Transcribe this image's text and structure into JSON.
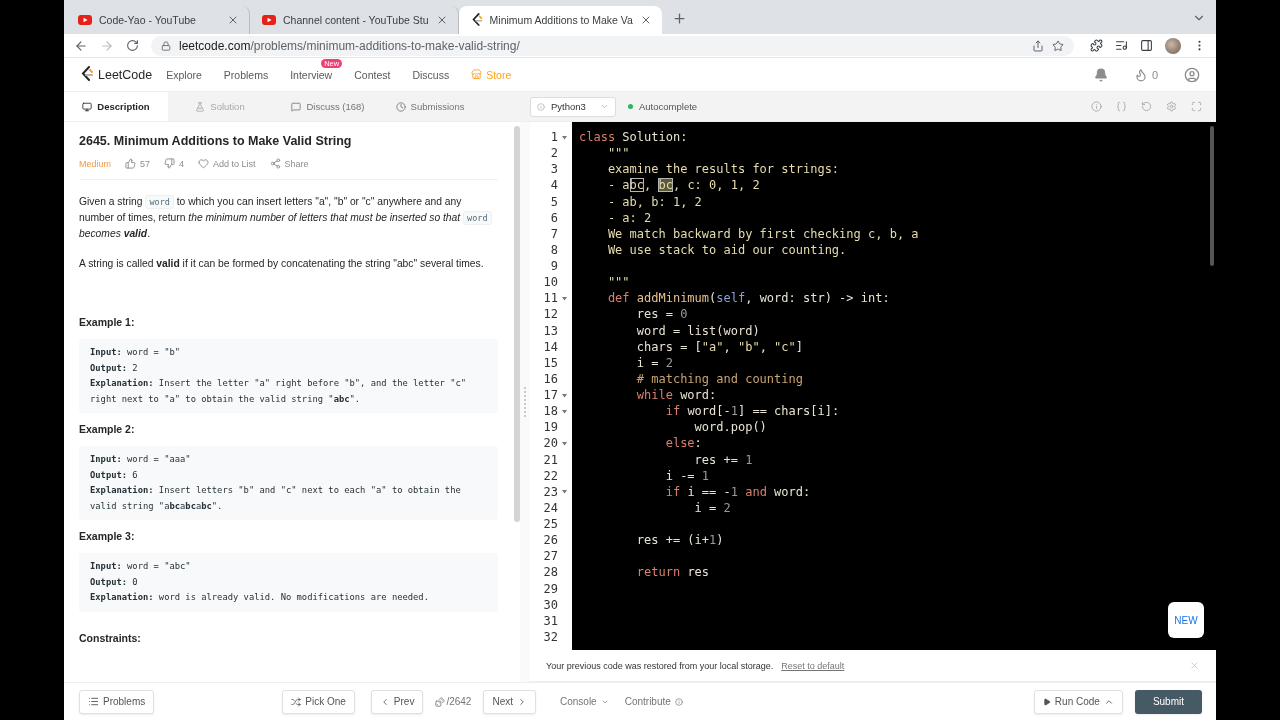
{
  "browser": {
    "tabs": [
      {
        "title": "Code-Yao - YouTube",
        "selected": false
      },
      {
        "title": "Channel content - YouTube Stu",
        "selected": false
      },
      {
        "title": "Minimum Additions to Make Va",
        "selected": true
      }
    ],
    "url": {
      "host": "leetcode.com",
      "path": "/problems/minimum-additions-to-make-valid-string/"
    }
  },
  "nav": {
    "logo": "LeetCode",
    "items": [
      {
        "label": "Explore"
      },
      {
        "label": "Problems"
      },
      {
        "label": "Interview",
        "badge": "New"
      },
      {
        "label": "Contest"
      },
      {
        "label": "Discuss"
      }
    ],
    "store": "Store",
    "streak": "0"
  },
  "panel_tabs": [
    {
      "label": "Description",
      "selected": true,
      "disabled": false
    },
    {
      "label": "Solution",
      "selected": false,
      "disabled": true
    },
    {
      "label": "Discuss (168)",
      "selected": false,
      "disabled": false
    },
    {
      "label": "Submissions",
      "selected": false,
      "disabled": false
    }
  ],
  "problem": {
    "title": "2645. Minimum Additions to Make Valid String",
    "difficulty": "Medium",
    "likes": "57",
    "dislikes": "4",
    "actions": [
      "Add to List",
      "Share"
    ],
    "paragraphs": [
      [
        {
          "text": "Given a string ",
          "kind": "plain"
        },
        {
          "text": "word",
          "kind": "code"
        },
        {
          "text": " to which you can insert letters \"a\", \"b\" or \"c\" anywhere and any number of times, return ",
          "kind": "plain"
        },
        {
          "text": "the minimum number of letters that must be inserted so that ",
          "kind": "italic"
        },
        {
          "text": "word",
          "kind": "code"
        },
        {
          "text": " becomes ",
          "kind": "italic"
        },
        {
          "text": "valid",
          "kind": "bolditalic"
        },
        {
          "text": ".",
          "kind": "plain"
        }
      ],
      [
        {
          "text": "A string is called ",
          "kind": "plain"
        },
        {
          "text": "valid",
          "kind": "bold"
        },
        {
          "text": " if it can be formed by concatenating the string \"abc\" several times.",
          "kind": "plain"
        }
      ]
    ],
    "examples": [
      {
        "label": "Example 1:",
        "lines": [
          "**Input:** word = \"b\"",
          "**Output:** 2",
          "**Explanation:** Insert the letter \"a\" right before \"b\", and the letter \"c\" right next to \"a\" to obtain the valid string \"**abc**\"."
        ]
      },
      {
        "label": "Example 2:",
        "lines": [
          "**Input:** word = \"aaa\"",
          "**Output:** 6",
          "**Explanation:** Insert letters \"b\" and \"c\" next to each \"a\" to obtain the valid string \"a**bc**a**bc**a**bc**\"."
        ]
      },
      {
        "label": "Example 3:",
        "lines": [
          "**Input:** word = \"abc\"",
          "**Output:** 0",
          "**Explanation:** word is already valid. No modifications are needed."
        ]
      }
    ],
    "constraints_heading": "Constraints:"
  },
  "editor": {
    "language": "Python3",
    "autocomplete": {
      "label": "Autocomplete",
      "on": true
    },
    "lines": [
      {
        "n": "1",
        "foldable": true,
        "tokens": [
          {
            "t": "class",
            "kind": "kw"
          },
          {
            "t": " Solution:",
            "kind": "plain"
          }
        ]
      },
      {
        "n": "2",
        "foldable": false,
        "tokens": [
          {
            "t": "    \"\"\"",
            "kind": "doc"
          }
        ]
      },
      {
        "n": "3",
        "foldable": false,
        "tokens": [
          {
            "t": "    examine the results for strings:",
            "kind": "doc"
          }
        ]
      },
      {
        "n": "4",
        "foldable": false,
        "tokens": [
          {
            "t": "    - a",
            "kind": "doc"
          },
          {
            "t": "bc",
            "kind": "match"
          },
          {
            "t": ", ",
            "kind": "doc"
          },
          {
            "t": "bc",
            "kind": "match_active"
          },
          {
            "t": ", c: 0, 1, 2",
            "kind": "doc"
          }
        ]
      },
      {
        "n": "5",
        "foldable": false,
        "tokens": [
          {
            "t": "    - ab, b: 1, 2",
            "kind": "doc"
          }
        ]
      },
      {
        "n": "6",
        "foldable": false,
        "tokens": [
          {
            "t": "    - a: 2",
            "kind": "doc"
          }
        ]
      },
      {
        "n": "7",
        "foldable": false,
        "tokens": [
          {
            "t": "    We match backward by first checking c, b, a",
            "kind": "doc"
          }
        ]
      },
      {
        "n": "8",
        "foldable": false,
        "tokens": [
          {
            "t": "    We use stack to aid our counting.",
            "kind": "doc"
          }
        ]
      },
      {
        "n": "9",
        "foldable": false
      },
      {
        "n": "10",
        "foldable": false,
        "tokens": [
          {
            "t": "    \"\"\"",
            "kind": "doc"
          }
        ]
      },
      {
        "n": "11",
        "foldable": true,
        "tokens": [
          {
            "t": "    def ",
            "kind": "kw"
          },
          {
            "t": "addMinimum",
            "kind": "func"
          },
          {
            "t": "(",
            "kind": "plain"
          },
          {
            "t": "self",
            "kind": "self"
          },
          {
            "t": ", word: str) -> int:",
            "kind": "plain"
          }
        ]
      },
      {
        "n": "12",
        "foldable": false,
        "tokens": [
          {
            "t": "        res = ",
            "kind": "plain"
          },
          {
            "t": "0",
            "kind": "num"
          }
        ]
      },
      {
        "n": "13",
        "foldable": false,
        "tokens": [
          {
            "t": "        word = list(word)",
            "kind": "plain"
          }
        ]
      },
      {
        "n": "14",
        "foldable": false,
        "tokens": [
          {
            "t": "        chars = [",
            "kind": "plain"
          },
          {
            "t": "\"a\"",
            "kind": "str"
          },
          {
            "t": ", ",
            "kind": "plain"
          },
          {
            "t": "\"b\"",
            "kind": "str"
          },
          {
            "t": ", ",
            "kind": "plain"
          },
          {
            "t": "\"c\"",
            "kind": "str"
          },
          {
            "t": "]",
            "kind": "plain"
          }
        ]
      },
      {
        "n": "15",
        "foldable": false,
        "tokens": [
          {
            "t": "        i = ",
            "kind": "plain"
          },
          {
            "t": "2",
            "kind": "num"
          }
        ]
      },
      {
        "n": "16",
        "foldable": false,
        "tokens": [
          {
            "t": "        # matching and counting",
            "kind": "comment"
          }
        ]
      },
      {
        "n": "17",
        "foldable": true,
        "tokens": [
          {
            "t": "        while",
            "kind": "kw"
          },
          {
            "t": " word:",
            "kind": "plain"
          }
        ]
      },
      {
        "n": "18",
        "foldable": true,
        "tokens": [
          {
            "t": "            if",
            "kind": "kw"
          },
          {
            "t": " word[-",
            "kind": "plain"
          },
          {
            "t": "1",
            "kind": "num"
          },
          {
            "t": "] == chars[i]:",
            "kind": "plain"
          }
        ]
      },
      {
        "n": "19",
        "foldable": false,
        "tokens": [
          {
            "t": "                word.pop()",
            "kind": "plain"
          }
        ]
      },
      {
        "n": "20",
        "foldable": true,
        "tokens": [
          {
            "t": "            else",
            "kind": "kw"
          },
          {
            "t": ":",
            "kind": "plain"
          }
        ]
      },
      {
        "n": "21",
        "foldable": false,
        "tokens": [
          {
            "t": "                res += ",
            "kind": "plain"
          },
          {
            "t": "1",
            "kind": "num"
          }
        ]
      },
      {
        "n": "22",
        "foldable": false,
        "tokens": [
          {
            "t": "            i -= ",
            "kind": "plain"
          },
          {
            "t": "1",
            "kind": "num"
          }
        ]
      },
      {
        "n": "23",
        "foldable": true,
        "tokens": [
          {
            "t": "            if",
            "kind": "kw"
          },
          {
            "t": " i == -",
            "kind": "plain"
          },
          {
            "t": "1",
            "kind": "num"
          },
          {
            "t": " and",
            "kind": "kw"
          },
          {
            "t": " word:",
            "kind": "plain"
          }
        ]
      },
      {
        "n": "24",
        "foldable": false,
        "tokens": [
          {
            "t": "                i = ",
            "kind": "plain"
          },
          {
            "t": "2",
            "kind": "num"
          }
        ]
      },
      {
        "n": "25",
        "foldable": false
      },
      {
        "n": "26",
        "foldable": false,
        "tokens": [
          {
            "t": "        res += (i+",
            "kind": "plain"
          },
          {
            "t": "1",
            "kind": "num"
          },
          {
            "t": ")",
            "kind": "plain"
          }
        ]
      },
      {
        "n": "27",
        "foldable": false
      },
      {
        "n": "28",
        "foldable": false,
        "tokens": [
          {
            "t": "        return",
            "kind": "kw"
          },
          {
            "t": " res",
            "kind": "plain"
          }
        ]
      },
      {
        "n": "29",
        "foldable": false
      },
      {
        "n": "30",
        "foldable": false
      },
      {
        "n": "31",
        "foldable": false
      },
      {
        "n": "32",
        "foldable": false
      }
    ],
    "new_badge": "NEW",
    "notice": {
      "text": "Your previous code was restored from your local storage.",
      "link": "Reset to default"
    }
  },
  "bottom_bar": {
    "problems": "Problems",
    "pick_one": "Pick One",
    "prev": "Prev",
    "counter": "/2642",
    "next": "Next",
    "console": "Console",
    "contribute": "Contribute",
    "run_code": "Run Code",
    "submit": "Submit"
  }
}
